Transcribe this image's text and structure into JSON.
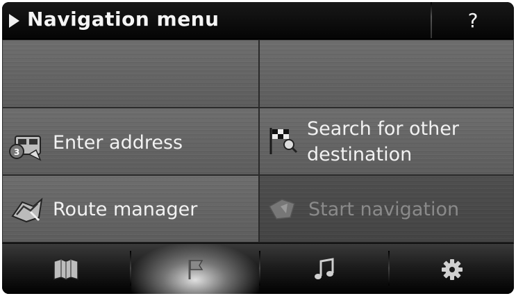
{
  "header": {
    "title": "Navigation menu",
    "help_label": "?"
  },
  "menu": {
    "enter_address": "Enter address",
    "search_other_line1": "Search for other",
    "search_other_line2": "destination",
    "route_manager": "Route manager",
    "start_navigation": "Start navigation"
  },
  "bottom_tabs": [
    {
      "icon": "map-icon",
      "active": false
    },
    {
      "icon": "flag-icon",
      "active": true
    },
    {
      "icon": "music-note-icon",
      "active": false
    },
    {
      "icon": "gear-icon",
      "active": false
    }
  ],
  "colors": {
    "tile": "#666666",
    "tile_disabled": "#484848",
    "text": "#f2f2f2",
    "text_disabled": "#8a8a8a"
  }
}
